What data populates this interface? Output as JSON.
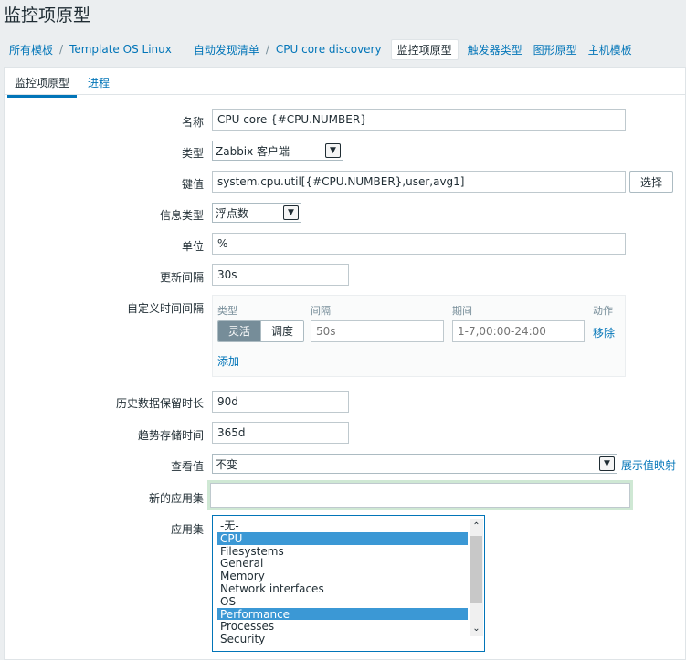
{
  "page": {
    "title": "监控项原型"
  },
  "breadcrumb": {
    "all_templates": "所有模板",
    "template": "Template OS Linux",
    "discovery_list": "自动发现清单",
    "discovery_rule": "CPU core discovery",
    "item_prototypes": "监控项原型",
    "trigger_prototypes": "触发器类型",
    "graph_prototypes": "图形原型",
    "host_prototypes": "主机模板",
    "separator": "/"
  },
  "tabs": {
    "item": "监控项原型",
    "process": "进程"
  },
  "form": {
    "name_label": "名称",
    "name_value": "CPU core {#CPU.NUMBER}",
    "type_label": "类型",
    "type_value": "Zabbix 客户端",
    "key_label": "键值",
    "key_value": "system.cpu.util[{#CPU.NUMBER},user,avg1]",
    "key_select_button": "选择",
    "info_type_label": "信息类型",
    "info_type_value": "浮点数",
    "units_label": "单位",
    "units_value": "%",
    "update_interval_label": "更新间隔",
    "update_interval_value": "30s",
    "custom_intervals_label": "自定义时间间隔",
    "custom_intervals": {
      "col_type": "类型",
      "col_interval": "间隔",
      "col_period": "期间",
      "col_action": "动作",
      "flexible": "灵活",
      "scheduling": "调度",
      "interval_placeholder": "50s",
      "period_placeholder": "1-7,00:00-24:00",
      "remove": "移除",
      "add": "添加"
    },
    "history_label": "历史数据保留时长",
    "history_value": "90d",
    "trends_label": "趋势存储时间",
    "trends_value": "365d",
    "valuemap_label": "查看值",
    "valuemap_value": "不变",
    "valuemap_link": "展示值映射",
    "new_app_label": "新的应用集",
    "new_app_value": "",
    "apps_label": "应用集",
    "applications": [
      {
        "label": "-无-",
        "selected": false
      },
      {
        "label": "CPU",
        "selected": true
      },
      {
        "label": "Filesystems",
        "selected": false
      },
      {
        "label": "General",
        "selected": false
      },
      {
        "label": "Memory",
        "selected": false
      },
      {
        "label": "Network interfaces",
        "selected": false
      },
      {
        "label": "OS",
        "selected": false
      },
      {
        "label": "Performance",
        "selected": true
      },
      {
        "label": "Processes",
        "selected": false
      },
      {
        "label": "Security",
        "selected": false
      }
    ]
  },
  "icons": {
    "dropdown": "chevron-down-icon",
    "scroll_up": "chevron-up-icon",
    "scroll_down": "chevron-down-icon"
  },
  "colors": {
    "link": "#0275b8",
    "selected": "#3b98d5",
    "segment_on": "#768d99"
  }
}
